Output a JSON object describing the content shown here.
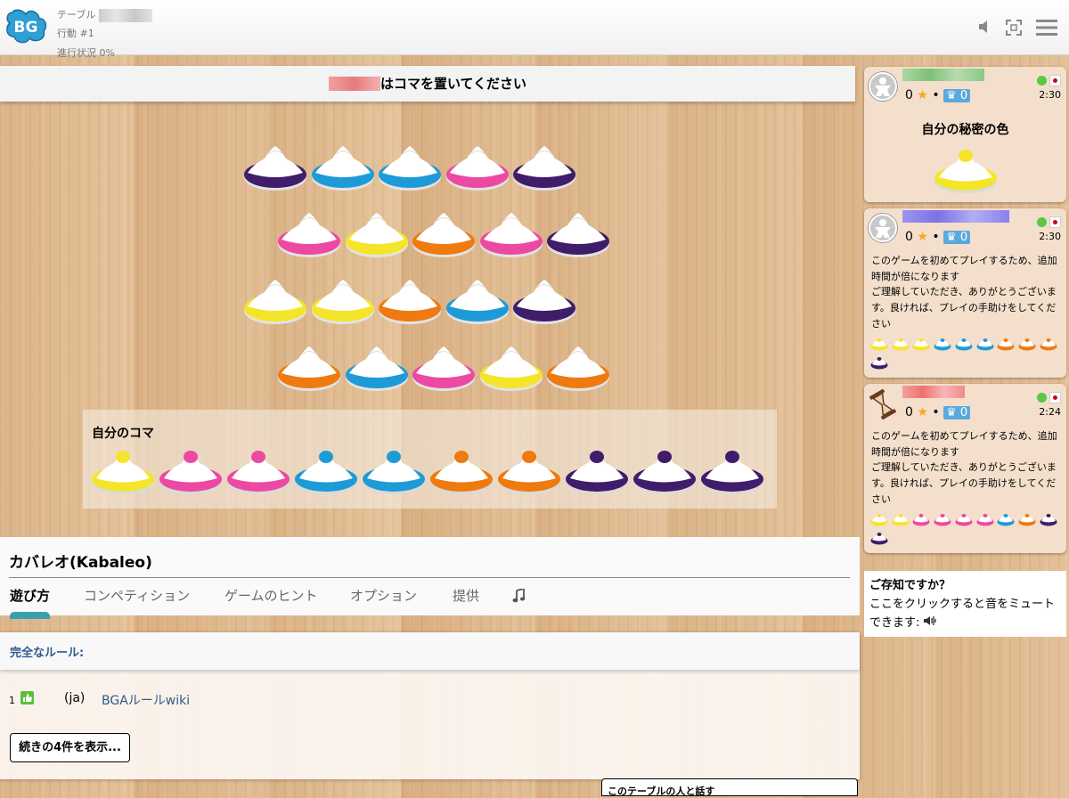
{
  "header": {
    "table_label": "テーブル",
    "action_label": "行動 #1",
    "progress_label": "進行状況 0%",
    "icons": [
      "speaker-icon",
      "fullscreen-icon",
      "menu-icon"
    ]
  },
  "banner": {
    "text": "はコマを置いてください"
  },
  "board": {
    "rows": [
      [
        "purple",
        "blue",
        "blue",
        "pink",
        "purple"
      ],
      [
        "pink",
        "yellow",
        "orange",
        "pink",
        "purple"
      ],
      [
        "yellow",
        "yellow",
        "orange",
        "blue",
        "purple"
      ],
      [
        "orange",
        "blue",
        "pink",
        "yellow",
        "orange"
      ]
    ]
  },
  "hand": {
    "label": "自分のコマ",
    "pieces": [
      "yellow",
      "pink",
      "pink",
      "blue",
      "blue",
      "orange",
      "orange",
      "purple",
      "purple",
      "purple"
    ]
  },
  "game": {
    "title": "カバレオ(Kabaleo)",
    "tabs": [
      "遊び方",
      "コンペティション",
      "ゲームのヒント",
      "オプション",
      "提供"
    ],
    "music_icon": "music-note-icon"
  },
  "rules": {
    "header": "完全なルール:",
    "row_index": "1",
    "row_lang": "(ja)",
    "row_link": "BGAルールwiki",
    "more_button": "続きの4件を表示..."
  },
  "chat": {
    "label": "このテーブルの人と話す"
  },
  "players": [
    {
      "score": "0",
      "laurel": "0",
      "time": "2:30",
      "secret_label": "自分の秘密の色",
      "secret_color": "yellow",
      "name_color": "#8fc98a"
    },
    {
      "score": "0",
      "laurel": "0",
      "time": "2:30",
      "note": "このゲームを初めてプレイするため、追加時間が倍になります\nご理解していただき、ありがとうございます。良ければ、プレイの手助けをしてください",
      "pieces": [
        "yellow",
        "yellow",
        "yellow",
        "blue",
        "blue",
        "blue",
        "orange",
        "orange",
        "orange",
        "purple"
      ],
      "name_color": "#8f86e8"
    },
    {
      "score": "0",
      "laurel": "0",
      "time": "2:24",
      "note": "このゲームを初めてプレイするため、追加時間が倍になります\nご理解していただき、ありがとうございます。良ければ、プレイの手助けをしてください",
      "pieces": [
        "yellow",
        "yellow",
        "pink",
        "pink",
        "pink",
        "pink",
        "blue",
        "orange",
        "purple",
        "purple"
      ],
      "name_color": "#f08080"
    }
  ],
  "tip": {
    "title": "ご存知ですか？",
    "text": "ここをクリックすると音をミュートできます:"
  },
  "colors": {
    "purple": "#3f1d6a",
    "blue": "#1e9bd7",
    "pink": "#ec4aa2",
    "yellow": "#f4e52a",
    "orange": "#ee7a10",
    "tab_indicator": "#3a9fae",
    "link": "#2e5a8b"
  }
}
